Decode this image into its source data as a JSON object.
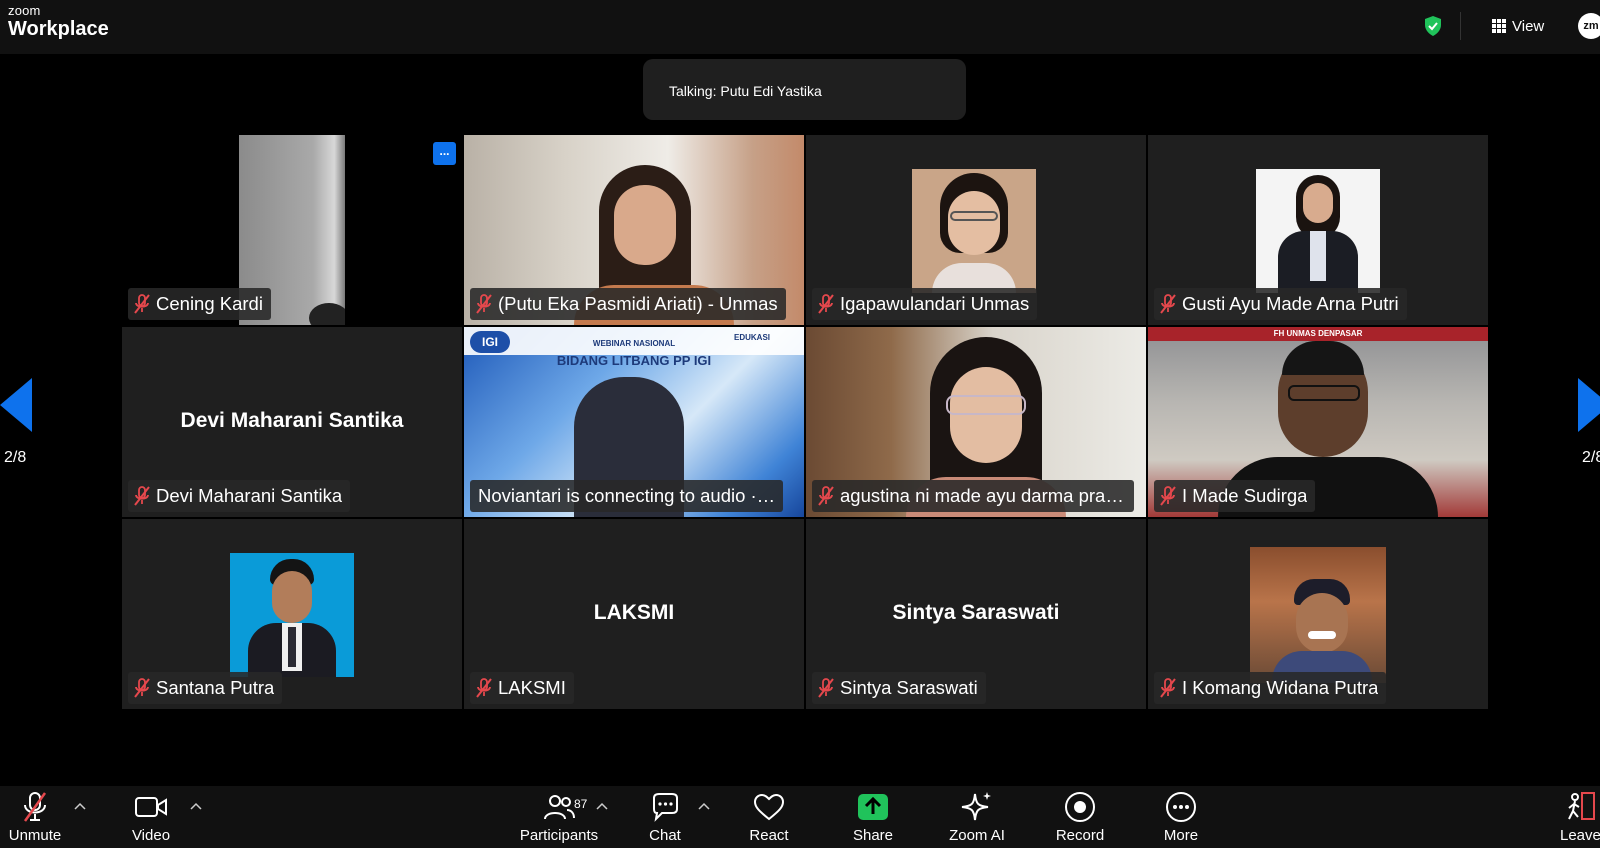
{
  "app": {
    "brand_small": "zoom",
    "brand_big": "Workplace"
  },
  "header": {
    "view_label": "View",
    "avatar_initials": "zm"
  },
  "talking_banner": "Talking: Putu Edi Yastika",
  "pagination": {
    "left": "2/8",
    "right": "2/8"
  },
  "tiles": [
    {
      "name": "Cening Kardi",
      "video": true,
      "big_name": ""
    },
    {
      "name": "(Putu Eka Pasmidi Ariati) - Unmas",
      "video": true,
      "big_name": ""
    },
    {
      "name": "Igapawulandari Unmas",
      "video": true,
      "big_name": ""
    },
    {
      "name": "Gusti Ayu Made Arna Putri",
      "video": true,
      "big_name": ""
    },
    {
      "name": "Devi Maharani Santika",
      "video": false,
      "big_name": "Devi Maharani Santika"
    },
    {
      "name": "Noviantari is connecting to audio ·…",
      "video": true,
      "big_name": ""
    },
    {
      "name": "agustina ni made ayu darma prati...",
      "video": true,
      "big_name": ""
    },
    {
      "name": "I Made Sudirga",
      "video": true,
      "big_name": ""
    },
    {
      "name": "Santana Putra",
      "video": true,
      "big_name": ""
    },
    {
      "name": "LAKSMI",
      "video": false,
      "big_name": "LAKSMI"
    },
    {
      "name": "Sintya Saraswati",
      "video": false,
      "big_name": "Sintya Saraswati"
    },
    {
      "name": "I Komang Widana Putra",
      "video": true,
      "big_name": ""
    }
  ],
  "tile_menu_label": "...",
  "webinar_banner": {
    "org": "IGI",
    "title": "WEBINAR NASIONAL",
    "subtitle": "BIDANG LITBANG PP IGI",
    "partner": "EDUKASI"
  },
  "fh_banner": "FH UNMAS DENPASAR",
  "toolbar": {
    "unmute": "Unmute",
    "video": "Video",
    "participants": "Participants",
    "participants_count": "87",
    "chat": "Chat",
    "react": "React",
    "share": "Share",
    "zoom_ai": "Zoom AI",
    "record": "Record",
    "more": "More",
    "leave": "Leave"
  },
  "colors": {
    "accent_blue": "#0e72ed",
    "share_green": "#20c35b",
    "mute_red": "#e5484d",
    "tile_bg": "#1f1f1f"
  }
}
